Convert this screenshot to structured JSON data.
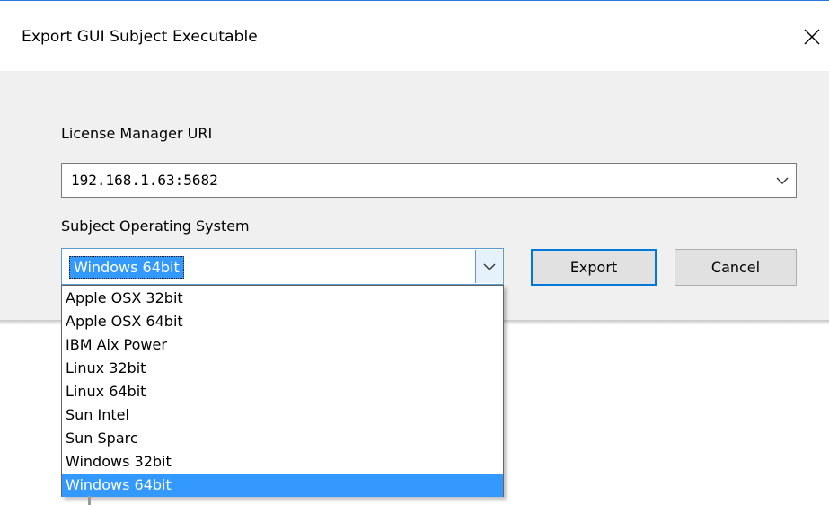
{
  "window": {
    "title": "Export GUI Subject Executable"
  },
  "license": {
    "label": "License Manager URI",
    "value": "192.168.1.63:5682"
  },
  "os": {
    "label": "Subject Operating System",
    "selected": "Windows 64bit",
    "options": [
      "Apple OSX 32bit",
      "Apple OSX 64bit",
      "IBM Aix Power",
      "Linux 32bit",
      "Linux 64bit",
      "Sun Intel",
      "Sun Sparc",
      "Windows 32bit",
      "Windows 64bit"
    ]
  },
  "buttons": {
    "export": "Export",
    "cancel": "Cancel"
  },
  "icons": {
    "close": "close-icon",
    "dropdown": "chevron-down-icon"
  },
  "colors": {
    "accent": "#0078d7",
    "selection": "#3399ff",
    "dialog_bg": "#f0f0f0"
  }
}
